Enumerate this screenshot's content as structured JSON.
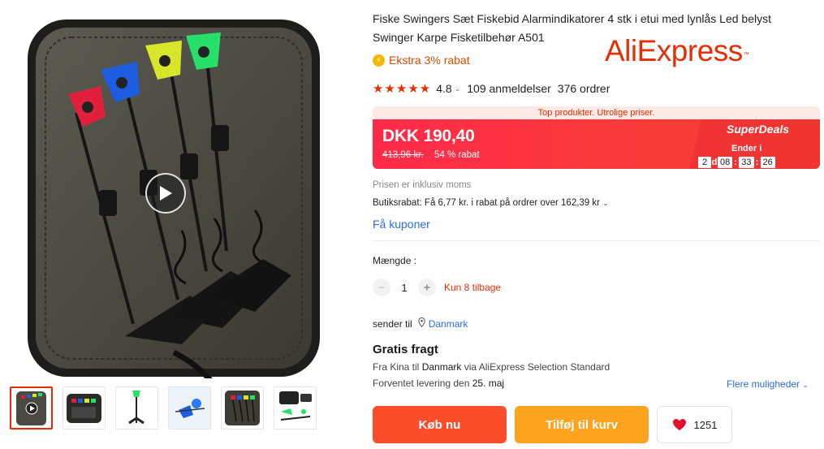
{
  "product": {
    "title": "Fiske Swingers Sæt Fiskebid Alarmindikatorer 4 stk i etui med lynlås Led belyst Swinger Karpe Fisketilbehør A501",
    "brand": "AliExpress",
    "brand_mark": "™",
    "extra_discount": "Ekstra 3% rabat",
    "rating": "4.8",
    "reviews": "109 anmeldelser",
    "orders": "376 ordrer"
  },
  "deal": {
    "strip": "Top produkter. Utrolige priser.",
    "price": "DKK 190,40",
    "old_price": "413,96 kr.",
    "discount": "54 % rabat",
    "label": "SuperDeals",
    "ends_label": "Ender i",
    "timer": {
      "days": "2",
      "days_unit": "d",
      "hours": "08",
      "minutes": "33",
      "seconds": "26"
    }
  },
  "pricing_info": {
    "vat": "Prisen er inklusiv moms",
    "store_discount": "Butiksrabat: Få 6,77 kr. i rabat på ordrer over 162,39 kr",
    "coupons": "Få kuponer"
  },
  "quantity": {
    "label": "Mængde :",
    "value": "1",
    "stock": "Kun 8 tilbage"
  },
  "shipping": {
    "send_to_label": "sender til",
    "country": "Danmark",
    "title": "Gratis fragt",
    "from_prefix": "Fra Kina til",
    "from_country": "Danmark",
    "via": "via AliExpress Selection Standard",
    "eta_prefix": "Forventet levering den",
    "eta_date": "25. maj",
    "more_options": "Flere muligheder"
  },
  "actions": {
    "buy_now": "Køb nu",
    "add_to_cart": "Tilføj til kurv",
    "wishlist_count": "1251"
  },
  "icons": {
    "coin": "lightning-coin-icon",
    "play": "play-icon",
    "location": "location-pin-icon",
    "heart": "heart-icon",
    "chevron": "chevron-down-icon"
  },
  "colors": {
    "accent": "#e62e04",
    "link": "#2b6fd5",
    "buy": "#fc4d2b",
    "cart": "#fda31d"
  }
}
